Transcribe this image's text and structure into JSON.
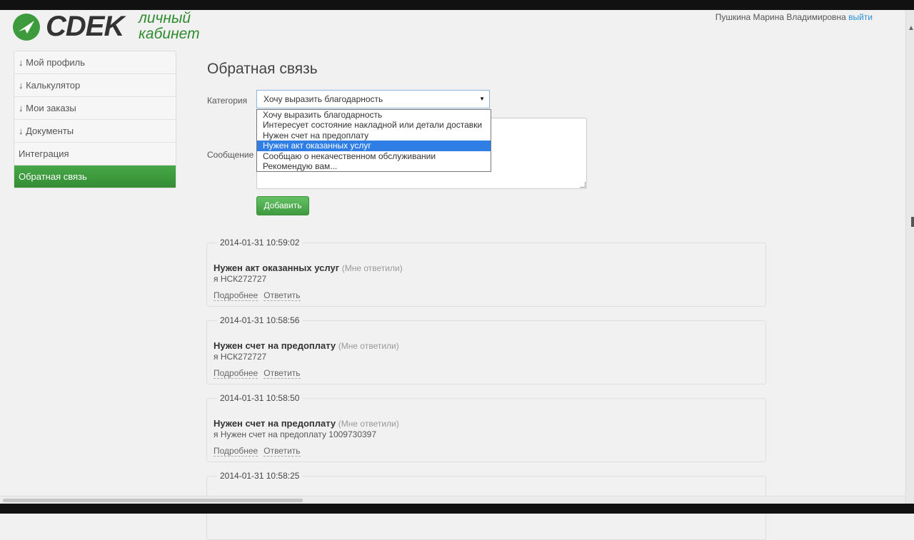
{
  "header": {
    "logo_text": "CDEK",
    "logo_sub_line1": "личный",
    "logo_sub_line2": "кабинет",
    "user_name": "Пушкина Марина Владимировна",
    "logout_label": "выйти"
  },
  "sidebar": {
    "items": [
      {
        "label": "↓ Мой профиль"
      },
      {
        "label": "↓ Калькулятор"
      },
      {
        "label": "↓ Мои заказы"
      },
      {
        "label": "↓ Документы"
      },
      {
        "label": "Интеграция"
      },
      {
        "label": "Обратная связь",
        "active": true
      }
    ]
  },
  "form": {
    "title": "Обратная связь",
    "category_label": "Категория",
    "category_value": "Хочу выразить благодарность",
    "message_label": "Сообщение",
    "submit_label": "Добавить",
    "options": [
      "Хочу выразить благодарность",
      "Интересует состояние накладной или детали доставки",
      "Нужен счет на предоплату",
      "Нужен акт оказанных услуг",
      "Сообщаю о некачественном обслуживании",
      "Рекомендую вам..."
    ],
    "highlighted_option_index": 3
  },
  "feed": [
    {
      "date": "2014-01-31 10:59:02",
      "title": "Нужен акт оказанных услуг",
      "status": "(Мне ответили)",
      "from": "я НСК272727",
      "more": "Подробнее",
      "reply": "Ответить"
    },
    {
      "date": "2014-01-31 10:58:56",
      "title": "Нужен счет на предоплату",
      "status": "(Мне ответили)",
      "from": "я НСК272727",
      "more": "Подробнее",
      "reply": "Ответить"
    },
    {
      "date": "2014-01-31 10:58:50",
      "title": "Нужен счет на предоплату",
      "status": "(Мне ответили)",
      "from": "я Нужен счет на предоплату 1009730397",
      "more": "Подробнее",
      "reply": "Ответить"
    },
    {
      "date": "2014-01-31 10:58:25"
    }
  ],
  "colors": {
    "accent_green": "#3d9b3d",
    "link_blue": "#2a8fd5",
    "highlight_blue": "#2f7ee6"
  }
}
